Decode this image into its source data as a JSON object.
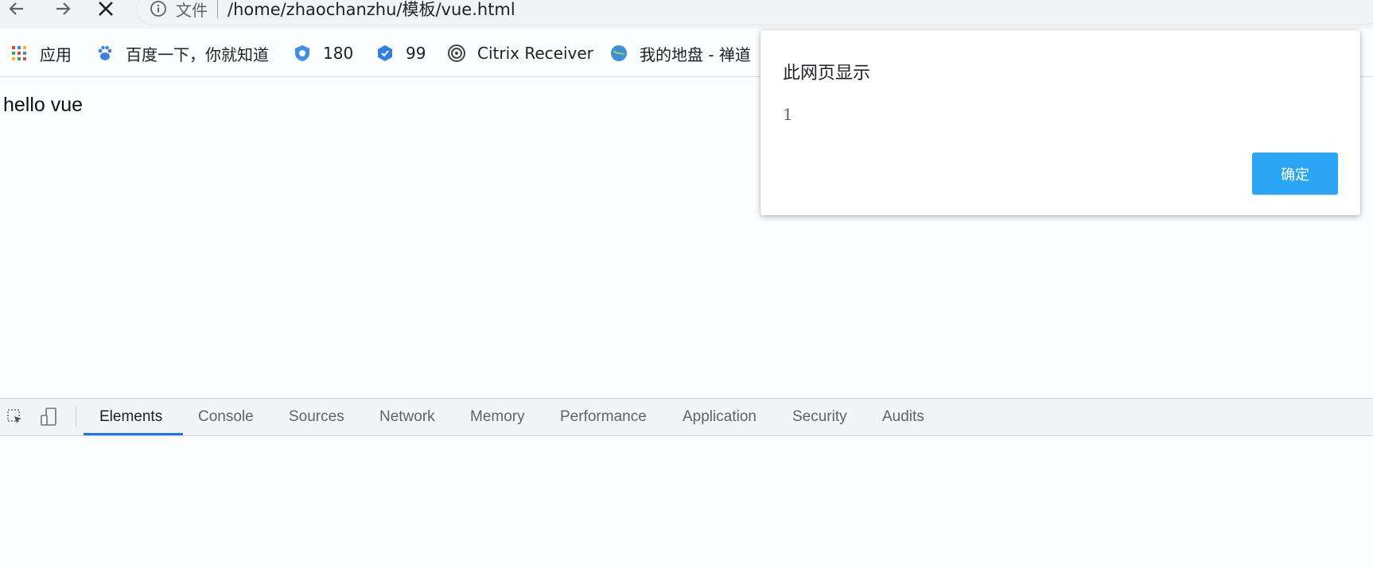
{
  "toolbar": {
    "scheme_label": "文件",
    "url": "/home/zhaochanzhu/模板/vue.html",
    "icons": [
      "back-arrow-icon",
      "forward-arrow-icon",
      "stop-icon",
      "info-icon"
    ]
  },
  "bookmarks": [
    {
      "label": "应用",
      "icon": "apps-grid-icon"
    },
    {
      "label": "百度一下，你就知道",
      "icon": "baidu-paw-icon"
    },
    {
      "label": "180",
      "icon": "shield-180-icon"
    },
    {
      "label": "99",
      "icon": "shield-99-icon"
    },
    {
      "label": "Citrix Receiver",
      "icon": "citrix-icon"
    },
    {
      "label": "我的地盘 - 禅道",
      "icon": "globe-icon"
    }
  ],
  "page": {
    "body_text": "hello vue"
  },
  "dialog": {
    "title": "此网页显示",
    "message": "1",
    "ok_label": "确定",
    "ok_color": "#2aa6f5"
  },
  "devtools": {
    "tabs": [
      "Elements",
      "Console",
      "Sources",
      "Network",
      "Memory",
      "Performance",
      "Application",
      "Security",
      "Audits"
    ],
    "active_tab": "Elements",
    "accent": "#1a73e8"
  }
}
